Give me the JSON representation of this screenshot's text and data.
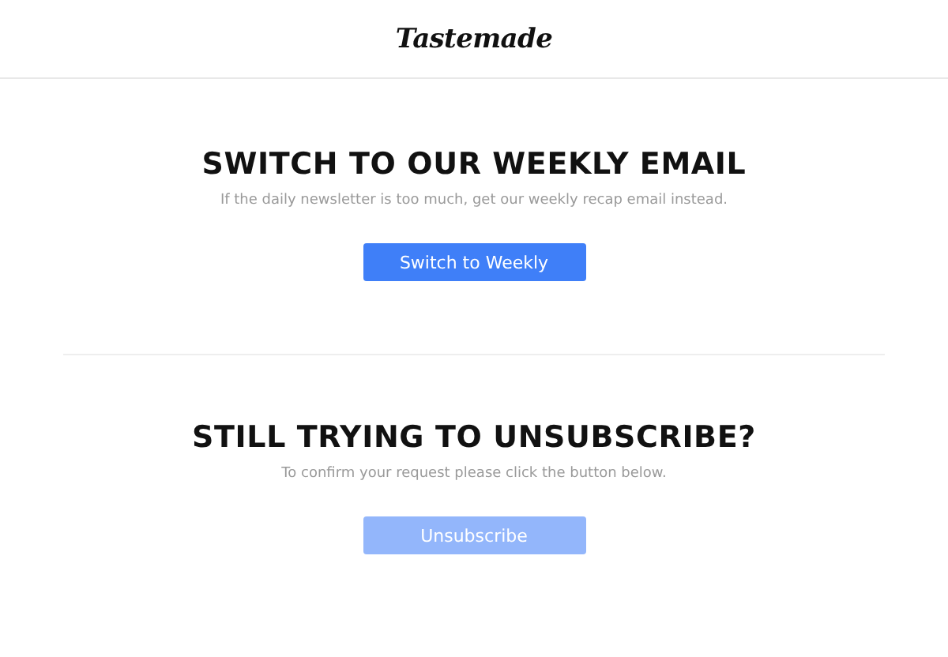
{
  "header": {
    "logo": "Tastemade"
  },
  "sections": [
    {
      "heading": "SWITCH TO OUR WEEKLY EMAIL",
      "text": "If the daily newsletter is too much, get our weekly recap email instead.",
      "button": {
        "label": "Switch to Weekly",
        "disabled": false
      }
    },
    {
      "heading": "STILL TRYING TO UNSUBSCRIBE?",
      "text": "To confirm your request please click the button below.",
      "button": {
        "label": "Unsubscribe",
        "disabled": true
      }
    }
  ]
}
